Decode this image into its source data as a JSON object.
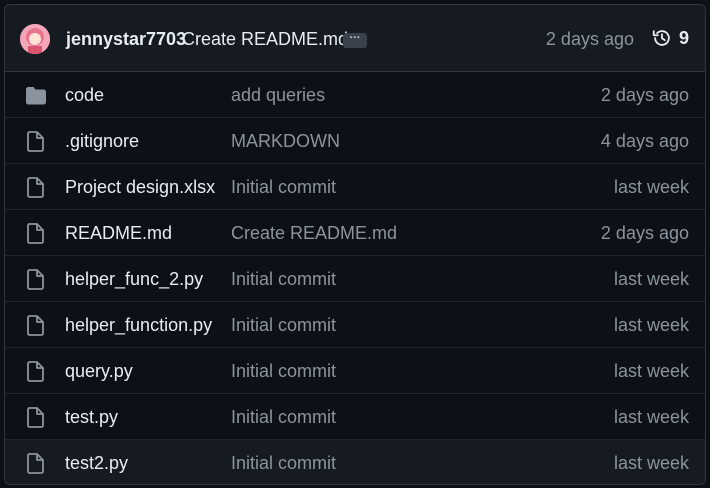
{
  "header": {
    "author": "jennystar7703",
    "message": "Create README.md",
    "ellipsis": "···",
    "time": "2 days ago",
    "history_count": "9",
    "history_icon": "history-clock-icon"
  },
  "files": [
    {
      "name": "code",
      "commit": "add queries",
      "time": "2 days ago",
      "icon": "folder-icon"
    },
    {
      "name": ".gitignore",
      "commit": "MARKDOWN",
      "time": "4 days ago",
      "icon": "file-icon"
    },
    {
      "name": "Project design.xlsx",
      "commit": "Initial commit",
      "time": "last week",
      "icon": "file-icon"
    },
    {
      "name": "README.md",
      "commit": "Create README.md",
      "time": "2 days ago",
      "icon": "file-icon"
    },
    {
      "name": "helper_func_2.py",
      "commit": "Initial commit",
      "time": "last week",
      "icon": "file-icon"
    },
    {
      "name": "helper_function.py",
      "commit": "Initial commit",
      "time": "last week",
      "icon": "file-icon"
    },
    {
      "name": "query.py",
      "commit": "Initial commit",
      "time": "last week",
      "icon": "file-icon"
    },
    {
      "name": "test.py",
      "commit": "Initial commit",
      "time": "last week",
      "icon": "file-icon"
    },
    {
      "name": "test2.py",
      "commit": "Initial commit",
      "time": "last week",
      "icon": "file-icon"
    }
  ],
  "colors": {
    "background": "#0d1117",
    "header_background": "#161b22",
    "border": "#30363d",
    "text": "#e6edf3",
    "muted": "#8b949e",
    "folder": "#8b949e"
  }
}
